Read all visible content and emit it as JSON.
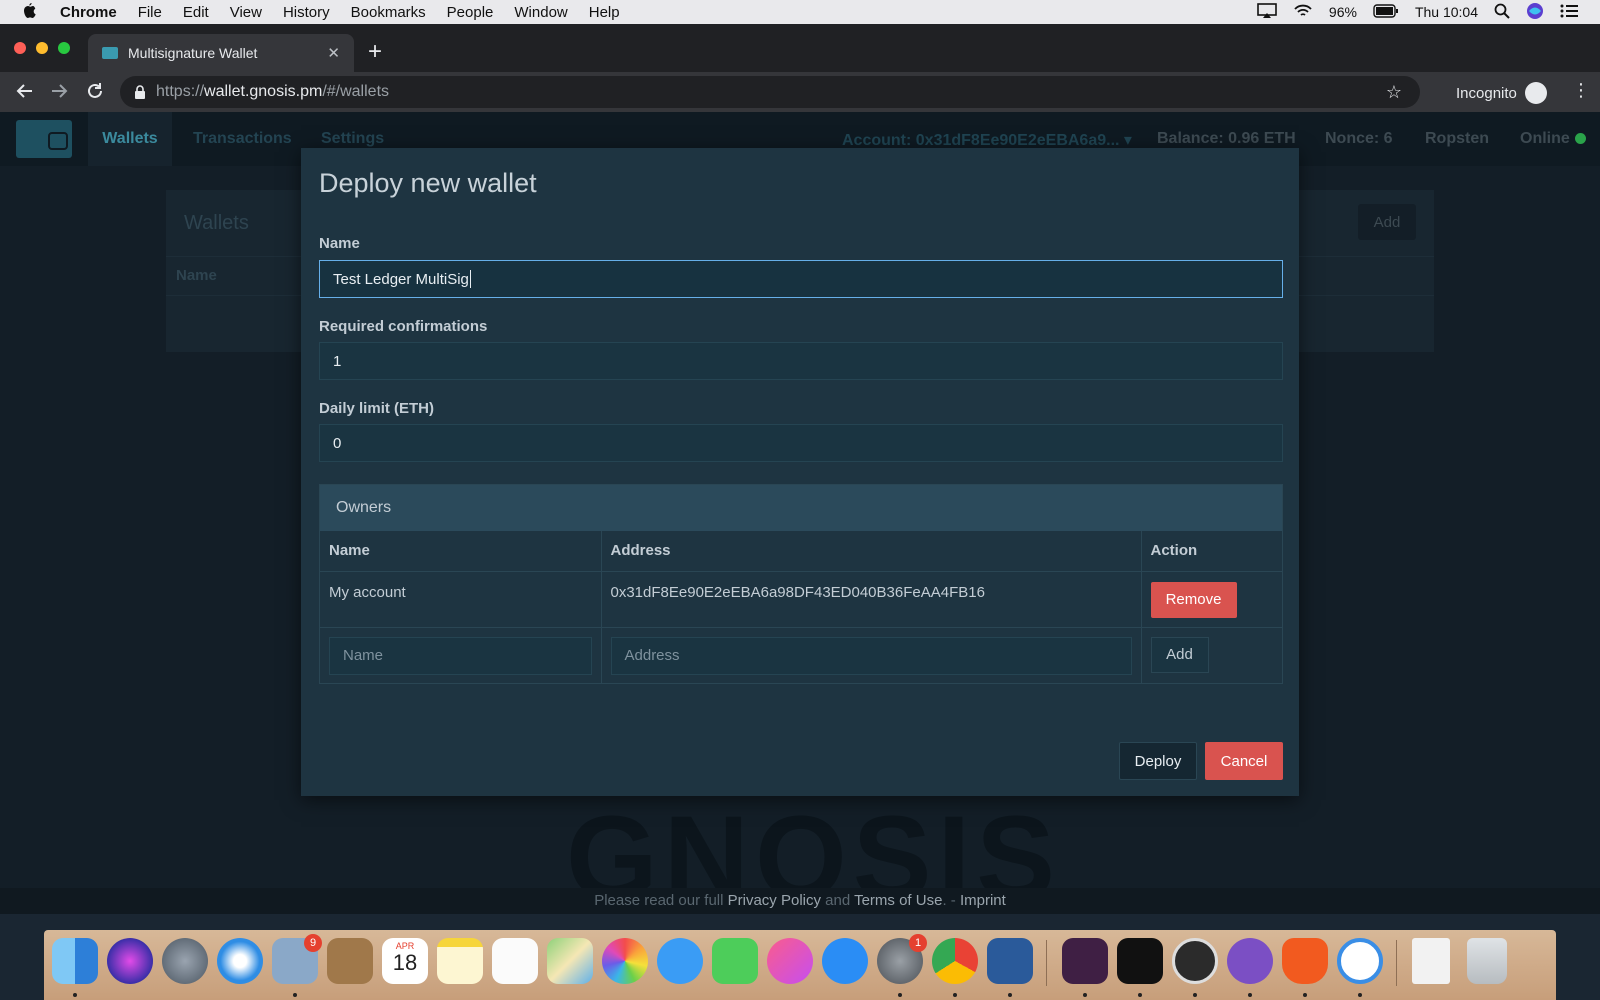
{
  "menubar": {
    "app": "Chrome",
    "items": [
      "File",
      "Edit",
      "View",
      "History",
      "Bookmarks",
      "People",
      "Window",
      "Help"
    ],
    "battery": "96%",
    "clock": "Thu 10:04"
  },
  "browser": {
    "tab_title": "Multisignature Wallet",
    "url_scheme": "https://",
    "url_host": "wallet.gnosis.pm",
    "url_path": "/#/wallets",
    "incognito_label": "Incognito"
  },
  "appnav": {
    "wallets": "Wallets",
    "transactions": "Transactions",
    "settings": "Settings",
    "account": "Account: 0x31dF8Ee90E2eEBA6a9... ▾",
    "balance": "Balance: 0.96 ETH",
    "nonce": "Nonce: 6",
    "network": "Ropsten",
    "status": "Online"
  },
  "background_panel": {
    "title": "Wallets",
    "add_label": "Add",
    "column_name": "Name"
  },
  "modal": {
    "title": "Deploy new wallet",
    "name_label": "Name",
    "name_value": "Test Ledger MultiSig",
    "confirmations_label": "Required confirmations",
    "confirmations_value": "1",
    "daily_limit_label": "Daily limit (ETH)",
    "daily_limit_value": "0",
    "owners": {
      "heading": "Owners",
      "col_name": "Name",
      "col_address": "Address",
      "col_action": "Action",
      "rows": [
        {
          "name": "My account",
          "address": "0x31dF8Ee90E2eEBA6a98DF43ED040B36FeAA4FB16",
          "action": "Remove"
        }
      ],
      "new_name_placeholder": "Name",
      "new_address_placeholder": "Address",
      "add_label": "Add"
    },
    "deploy_label": "Deploy",
    "cancel_label": "Cancel"
  },
  "watermark": "GNOSIS",
  "footer": {
    "prefix": "Please read our full ",
    "privacy": "Privacy Policy",
    "and": " and ",
    "terms": "Terms of Use",
    "sep": ". - ",
    "imprint": "Imprint"
  },
  "dock": {
    "mail_badge": "9",
    "calendar_month": "APR",
    "calendar_day": "18",
    "prefs_badge": "1"
  }
}
